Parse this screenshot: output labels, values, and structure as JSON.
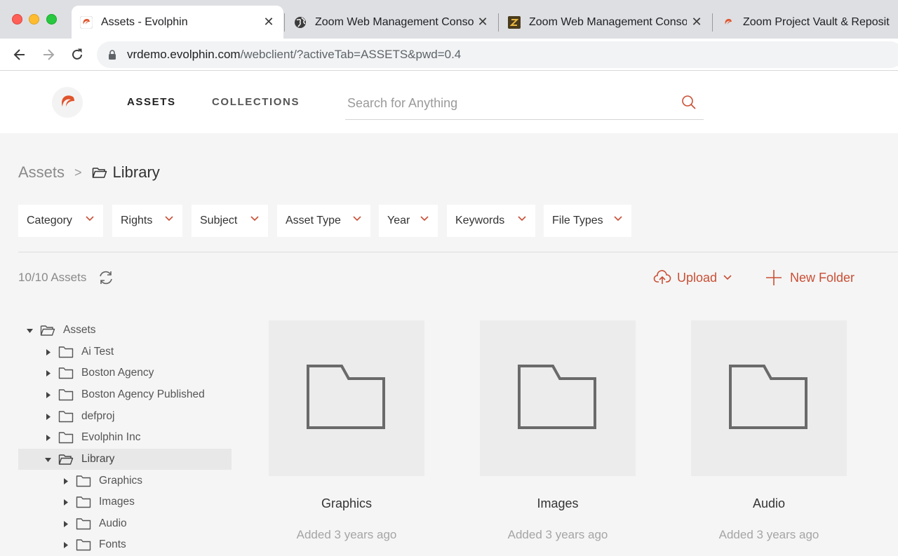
{
  "browser": {
    "tabs": [
      {
        "title": "Assets - Evolphin",
        "favicon": "evolphin-logo-icon",
        "active": true
      },
      {
        "title": "Zoom Web Management Conso",
        "favicon": "globe-icon",
        "active": false
      },
      {
        "title": "Zoom Web Management Conso",
        "favicon": "zoom-z-icon",
        "active": false
      },
      {
        "title": "Zoom Project Vault & Reposito",
        "favicon": "evolphin-logo-icon",
        "active": false
      }
    ],
    "url_host": "vrdemo.evolphin.com",
    "url_path": "/webclient/?activeTab=ASSETS&pwd=0.4"
  },
  "header": {
    "nav": {
      "assets": "ASSETS",
      "collections": "COLLECTIONS"
    },
    "search_placeholder": "Search for Anything"
  },
  "breadcrumb": {
    "root": "Assets",
    "separator": ">",
    "current": "Library"
  },
  "filters": [
    "Category",
    "Rights",
    "Subject",
    "Asset Type",
    "Year",
    "Keywords",
    "File Types"
  ],
  "toolbar": {
    "asset_count": "10/10 Assets",
    "upload_label": "Upload",
    "new_folder_label": "New Folder"
  },
  "tree": {
    "items": [
      {
        "label": "Assets",
        "level": 0,
        "expanded": true
      },
      {
        "label": "Ai Test",
        "level": 1,
        "expanded": false
      },
      {
        "label": "Boston Agency",
        "level": 1,
        "expanded": false
      },
      {
        "label": "Boston Agency Published",
        "level": 1,
        "expanded": false
      },
      {
        "label": "defproj",
        "level": 1,
        "expanded": false
      },
      {
        "label": "Evolphin Inc",
        "level": 1,
        "expanded": false
      },
      {
        "label": "Library",
        "level": 1,
        "expanded": true,
        "selected": true
      },
      {
        "label": "Graphics",
        "level": 2,
        "expanded": false
      },
      {
        "label": "Images",
        "level": 2,
        "expanded": false
      },
      {
        "label": "Audio",
        "level": 2,
        "expanded": false
      },
      {
        "label": "Fonts",
        "level": 2,
        "expanded": false
      }
    ]
  },
  "cards": [
    {
      "title": "Graphics",
      "meta": "Added 3 years ago"
    },
    {
      "title": "Images",
      "meta": "Added 3 years ago"
    },
    {
      "title": "Audio",
      "meta": "Added 3 years ago"
    }
  ],
  "colors": {
    "accent": "#c94f35",
    "brand": "#e0542c"
  }
}
